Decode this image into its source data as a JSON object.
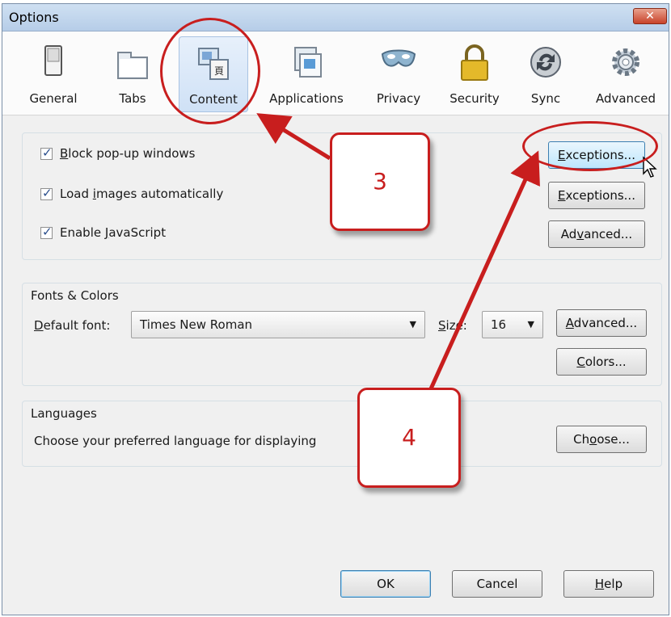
{
  "window": {
    "title": "Options",
    "close_label": "✕"
  },
  "toolbar": {
    "tabs": [
      {
        "label": "General"
      },
      {
        "label": "Tabs"
      },
      {
        "label": "Content",
        "selected": true
      },
      {
        "label": "Applications"
      },
      {
        "label": "Privacy"
      },
      {
        "label": "Security"
      },
      {
        "label": "Sync"
      },
      {
        "label": "Advanced"
      }
    ]
  },
  "content": {
    "checkboxes": [
      {
        "pre": "",
        "accel": "B",
        "post": "lock pop-up windows",
        "checked": true,
        "button": {
          "accel": "E",
          "post": "xceptions..."
        }
      },
      {
        "pre": "Load ",
        "accel": "i",
        "post": "mages automatically",
        "checked": true,
        "button": {
          "accel": "E",
          "post": "xceptions..."
        }
      },
      {
        "pre": "Enable ",
        "accel": "J",
        "post": "avaScript",
        "checked": true,
        "button": {
          "pre": "Ad",
          "accel": "v",
          "post": "anced..."
        }
      }
    ],
    "fonts": {
      "title": "Fonts & Colors",
      "default_font_label": {
        "accel": "D",
        "post": "efault font:"
      },
      "default_font_value": "Times New Roman",
      "size_label": {
        "accel": "S",
        "post": "ize:"
      },
      "size_value": "16",
      "advanced_button": {
        "accel": "A",
        "post": "dvanced..."
      },
      "colors_button": {
        "accel": "C",
        "post": "olors..."
      }
    },
    "languages": {
      "title": "Languages",
      "description": "Choose your preferred language for displaying",
      "choose_button": {
        "pre": "Ch",
        "accel": "o",
        "post": "ose..."
      }
    }
  },
  "footer": {
    "ok_label": "OK",
    "cancel_label": "Cancel",
    "help_button": {
      "accel": "H",
      "post": "elp"
    }
  },
  "annotations": {
    "callout_3": "3",
    "callout_4": "4"
  },
  "colors": {
    "annotation_red": "#c81e1e",
    "hover_blue": "#bde6fd"
  }
}
